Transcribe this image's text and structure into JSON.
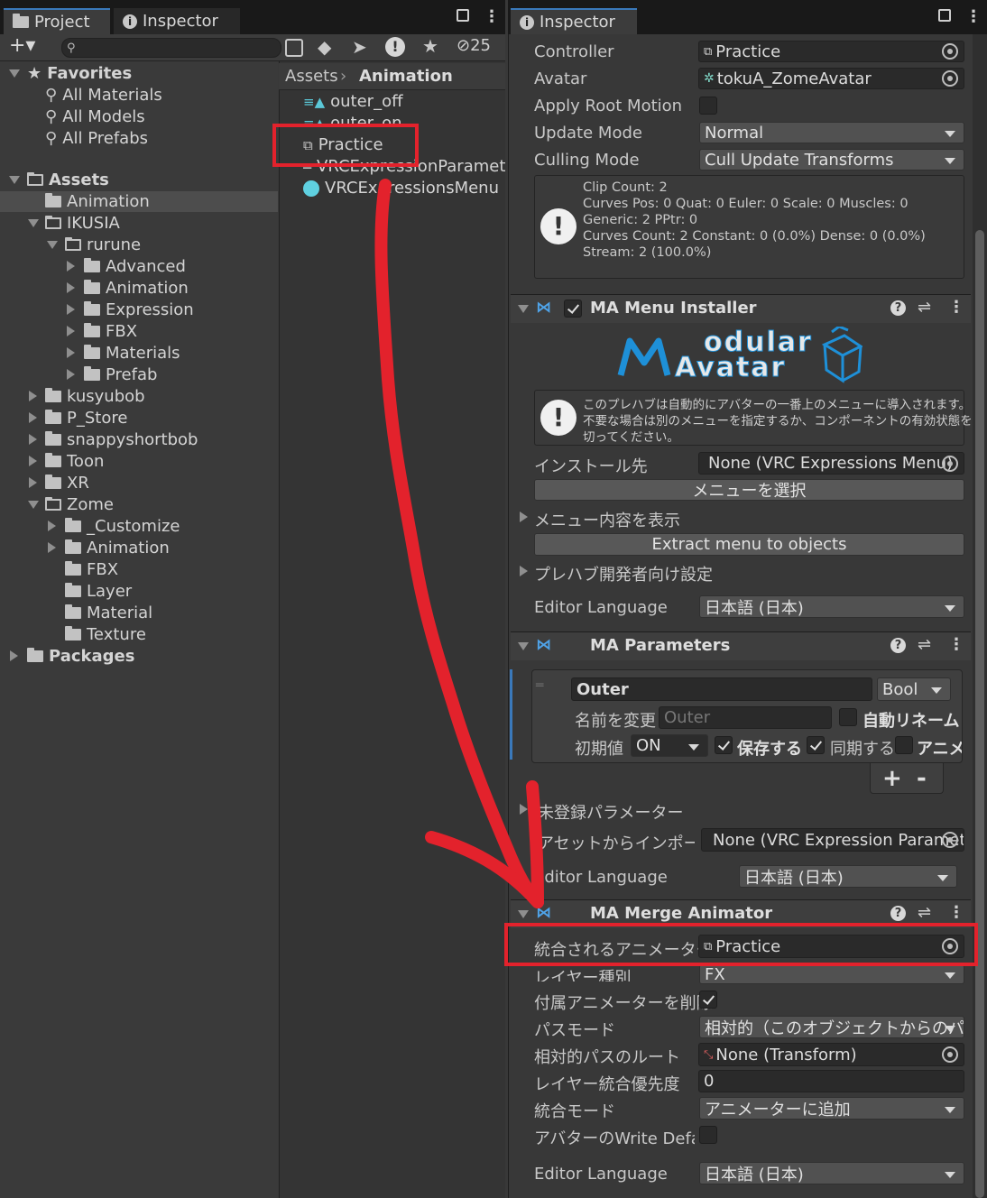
{
  "left_tabs": {
    "project": "Project",
    "inspector": "Inspector",
    "hidden_count": "25"
  },
  "right_tab": {
    "inspector": "Inspector"
  },
  "tree": {
    "favorites": "Favorites",
    "all_materials": "All Materials",
    "all_models": "All Models",
    "all_prefabs": "All Prefabs",
    "assets": "Assets",
    "animation": "Animation",
    "ikusia": "IKUSIA",
    "rurune": "rurune",
    "advanced": "Advanced",
    "rurune_animation": "Animation",
    "expression": "Expression",
    "fbx": "FBX",
    "materials": "Materials",
    "prefab": "Prefab",
    "kusyubob": "kusyubob",
    "p_store": "P_Store",
    "snappy": "snappyshortbob",
    "toon": "Toon",
    "xr": "XR",
    "zome": "Zome",
    "customize": "_Customize",
    "zome_animation": "Animation",
    "zome_fbx": "FBX",
    "layer": "Layer",
    "material": "Material",
    "texture": "Texture",
    "packages": "Packages"
  },
  "breadcrumb": {
    "root": "Assets",
    "current": "Animation"
  },
  "files": {
    "outer_off": "outer_off",
    "outer_on": "outer_on",
    "practice": "Practice",
    "params": "VRCExpressionParameters",
    "menu": "VRCExpressionsMenu"
  },
  "animator": {
    "controller_label": "Controller",
    "controller_value": "Practice",
    "avatar_label": "Avatar",
    "avatar_value": "tokuA_ZomeAvatar",
    "root_motion_label": "Apply Root Motion",
    "update_mode_label": "Update Mode",
    "update_mode_value": "Normal",
    "culling_label": "Culling Mode",
    "culling_value": "Cull Update Transforms",
    "info": [
      "Clip Count: 2",
      "Curves Pos: 0 Quat: 0 Euler: 0 Scale: 0 Muscles: 0",
      "Generic: 2 PPtr: 0",
      "Curves Count: 2 Constant: 0 (0.0%) Dense: 0 (0.0%)",
      "Stream: 2 (100.0%)"
    ]
  },
  "menu_installer": {
    "title": "MA Menu Installer",
    "logo_top": "odular",
    "logo_bottom": "Avatar",
    "help": [
      "このプレハブは自動的にアバターの一番上のメニューに導入されます。",
      "不要な場合は別のメニューを指定するか、コンポーネントの有効状態を",
      "切ってください。"
    ],
    "install_label": "インストール先",
    "install_value": "None (VRC Expressions Menu)",
    "select_menu": "メニューを選択",
    "show_menu": "メニュー内容を表示",
    "extract": "Extract menu to objects",
    "prefab_dev": "プレハブ開発者向け設定",
    "lang_label": "Editor Language",
    "lang_value": "日本語 (日本)"
  },
  "parameters": {
    "title": "MA Parameters",
    "name": "Outer",
    "type": "Bool",
    "rename_label": "名前を変更",
    "rename_placeholder": "Outer",
    "auto_rename": "自動リネーム",
    "default_label": "初期値",
    "default_value": "ON",
    "saved": "保存する",
    "synced": "同期する",
    "anim": "アニメ-",
    "plus": "+",
    "minus": "-",
    "unregistered": "未登録パラメーター",
    "import_label": "アセットからインポートする",
    "import_value": "None (VRC Expression Parameters)",
    "lang_label": "Editor Language",
    "lang_value": "日本語 (日本)"
  },
  "merge": {
    "title": "MA Merge Animator",
    "animator_label": "統合されるアニメーター",
    "animator_value": "Practice",
    "layer_label": "レイヤー種別",
    "layer_value": "FX",
    "delete_label": "付属アニメーターを削除",
    "path_label": "パスモード",
    "path_value": "相対的（このオブジェクトからのパスを使用）",
    "root_label": "相対的パスのルート",
    "root_value": "None (Transform)",
    "priority_label": "レイヤー統合優先度",
    "priority_value": "0",
    "mode_label": "統合モード",
    "mode_value": "アニメーターに追加",
    "writedef_label": "アバターのWrite Defaults設定に合わせる",
    "lang_label": "Editor Language",
    "lang_value": "日本語 (日本)"
  },
  "colors": {
    "accent": "#3a79bb",
    "annotation": "#e3222c",
    "panel": "#383838"
  }
}
